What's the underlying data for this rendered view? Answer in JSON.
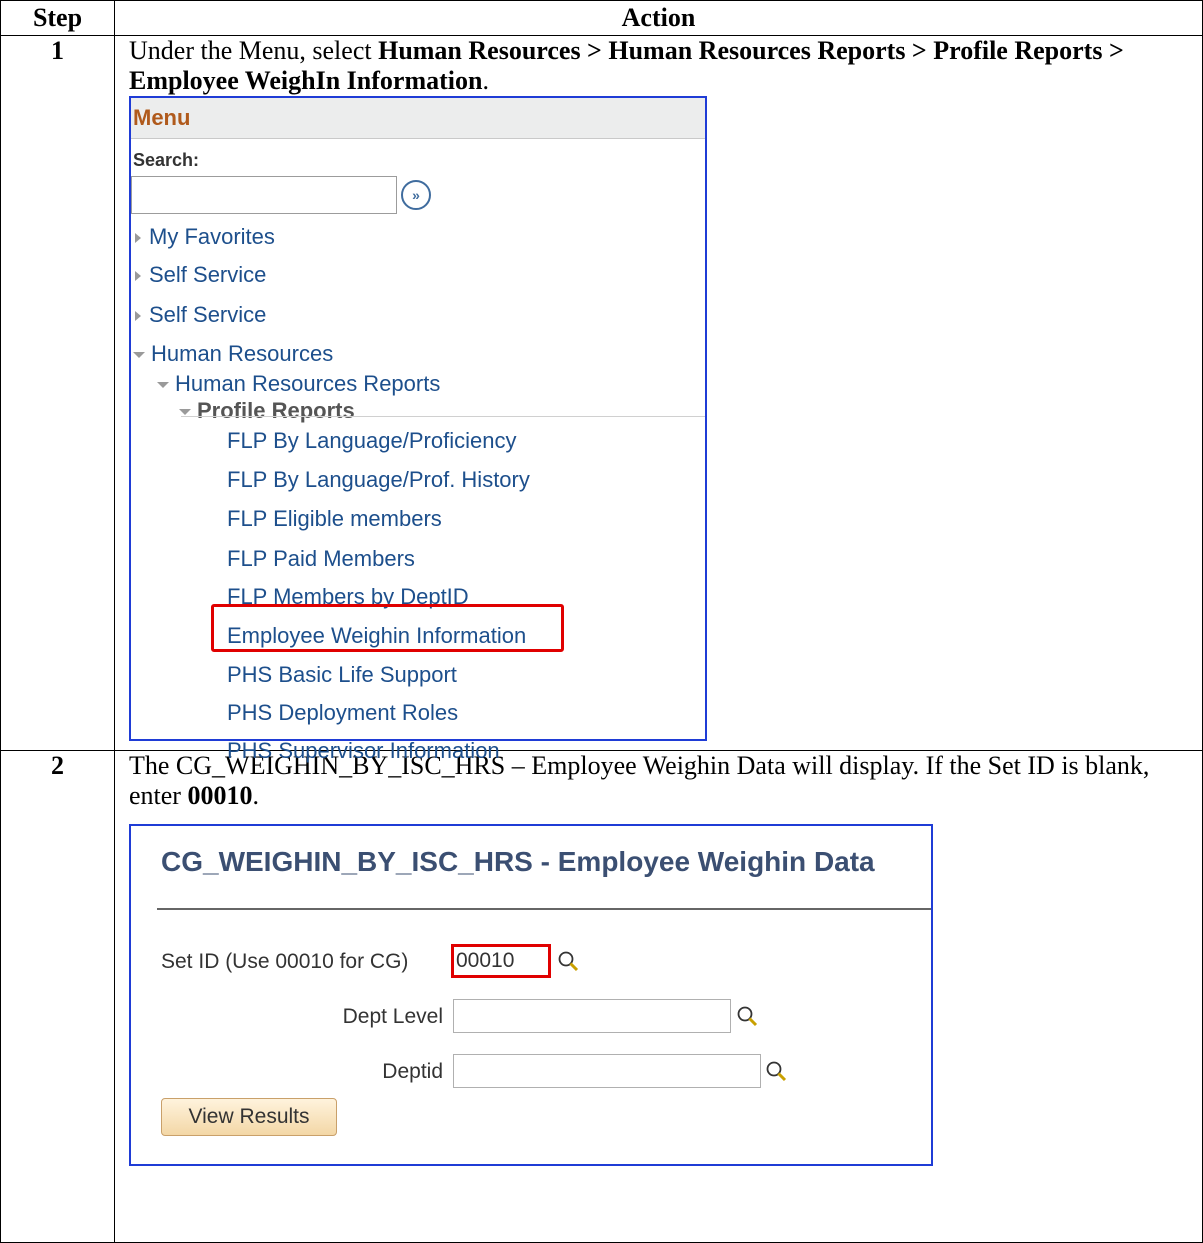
{
  "table": {
    "header_step": "Step",
    "header_action": "Action"
  },
  "step1": {
    "number": "1",
    "text_prefix": "Under the Menu, select ",
    "text_bold": "Human Resources > Human Resources Reports > Profile Reports > Employee WeighIn Information",
    "text_suffix": ".",
    "menu": {
      "title": "Menu",
      "search_label": "Search:",
      "search_value": "",
      "go_icon": "double-chevron-right-icon",
      "items": [
        "My Favorites",
        "Self Service",
        "Self Service",
        "Human Resources",
        "Human Resources Reports",
        "Profile Reports",
        "FLP By Language/Proficiency",
        "FLP By Language/Prof. History",
        "FLP Eligible members",
        "FLP Paid Members",
        "FLP Members by DeptID",
        "Employee Weighin Information",
        "PHS Basic Life Support",
        "PHS Deployment Roles",
        "PHS Supervisor Information"
      ],
      "highlight_color": "#e00000"
    }
  },
  "step2": {
    "number": "2",
    "text_prefix": "The CG_WEIGHIN_BY_ISC_HRS – Employee Weighin Data will display.  If the Set ID is blank, enter ",
    "text_bold": "00010",
    "text_suffix": ".",
    "form": {
      "title": "CG_WEIGHIN_BY_ISC_HRS - Employee Weighin Data",
      "setid_label": "Set ID (Use 00010 for CG)",
      "setid_value": "00010",
      "dept_level_label": "Dept Level",
      "dept_level_value": "",
      "deptid_label": "Deptid",
      "deptid_value": "",
      "lookup_icon": "magnifier-icon",
      "button_label": "View Results"
    }
  },
  "colors": {
    "link": "#1d4f8c",
    "menu_title": "#b05a1c",
    "frame": "#1f3cd6",
    "highlight": "#e00000"
  }
}
